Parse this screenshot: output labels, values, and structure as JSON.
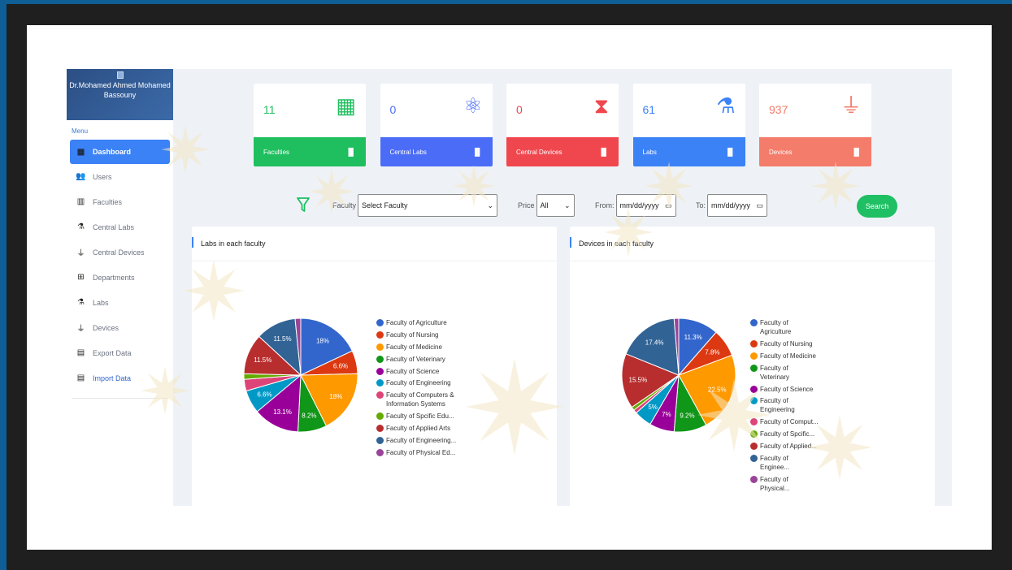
{
  "user": {
    "name": "Dr.Mohamed Ahmed Mohamed Bassouny"
  },
  "sidebar": {
    "menu_label": "Menu",
    "items": [
      {
        "label": "Dashboard",
        "icon": "dashboard-icon",
        "active": true
      },
      {
        "label": "Users",
        "icon": "users-icon"
      },
      {
        "label": "Faculties",
        "icon": "building-icon"
      },
      {
        "label": "Central Labs",
        "icon": "flask-icon"
      },
      {
        "label": "Central Devices",
        "icon": "plug-icon"
      },
      {
        "label": "Departments",
        "icon": "sitemap-icon"
      },
      {
        "label": "Labs",
        "icon": "flask-icon"
      },
      {
        "label": "Devices",
        "icon": "plug-icon"
      },
      {
        "label": "Export Data",
        "icon": "file-export-icon"
      },
      {
        "label": "Import Data",
        "icon": "file-import-icon"
      }
    ]
  },
  "stats": [
    {
      "count": "11",
      "label": "Faculties",
      "icon": "building-icon",
      "color": "#1fbf5f",
      "count_color": "#1fbf5f"
    },
    {
      "count": "0",
      "label": "Central Labs",
      "icon": "atom-icon",
      "color": "#4a6cf7",
      "count_color": "#4a6cf7"
    },
    {
      "count": "0",
      "label": "Central Devices",
      "icon": "dna-icon",
      "color": "#f0474e",
      "count_color": "#f0474e"
    },
    {
      "count": "61",
      "label": "Labs",
      "icon": "flask-icon",
      "color": "#3b82f6",
      "count_color": "#3b82f6"
    },
    {
      "count": "937",
      "label": "Devices",
      "icon": "plug-icon",
      "color": "#f47c6a",
      "count_color": "#f47c6a"
    }
  ],
  "filters": {
    "faculty_label": "Faculty",
    "faculty_value": "Select Faculty",
    "price_label": "Price",
    "price_value": "All",
    "from_label": "From:",
    "from_placeholder": "mm/dd/yyyy",
    "to_label": "To:",
    "to_placeholder": "mm/dd/yyyy",
    "search_label": "Search"
  },
  "chart_data": [
    {
      "type": "pie",
      "title": "Labs in each faculty",
      "categories": [
        "Faculty of Agriculture",
        "Faculty of Nursing",
        "Faculty of Medicine",
        "Faculty of Veterinary",
        "Faculty of Science",
        "Faculty of Engineering",
        "Faculty of Computers & Information Systems",
        "Faculty of Spcific Edu...",
        "Faculty of Applied Arts",
        "Faculty of Engineering...",
        "Faculty of Physical Ed..."
      ],
      "values": [
        18,
        6.6,
        18,
        8.2,
        13.1,
        6.6,
        3.3,
        1.6,
        11.5,
        11.5,
        1.6
      ],
      "slice_labels": [
        "18%",
        "6.6%",
        "18%",
        "8.2%",
        "13.1%",
        "6.6%",
        "",
        "",
        "11.5%",
        "11.5%",
        ""
      ],
      "colors": [
        "#3366cc",
        "#dc3912",
        "#ff9900",
        "#109618",
        "#990099",
        "#0099c6",
        "#dd4477",
        "#66aa00",
        "#b82e2e",
        "#316395",
        "#994499"
      ],
      "legend": "right"
    },
    {
      "type": "pie",
      "title": "Devices in each faculty",
      "categories": [
        "Faculty of Agriculture",
        "Faculty of Nursing",
        "Faculty of Medicine",
        "Faculty of Veterinary",
        "Faculty of Science",
        "Faculty of Engineering",
        "Faculty of Comput...",
        "Faculty of Spcific...",
        "Faculty of Applied...",
        "Faculty of Enginee...",
        "Faculty of Physical..."
      ],
      "values": [
        11.3,
        7.8,
        22.5,
        9.2,
        7,
        5,
        1,
        1,
        15.5,
        17.4,
        1.3
      ],
      "slice_labels": [
        "11.3%",
        "7.8%",
        "22.5%",
        "9.2%",
        "7%",
        "5%",
        "",
        "",
        "15.5%",
        "17.4%",
        ""
      ],
      "colors": [
        "#3366cc",
        "#dc3912",
        "#ff9900",
        "#109618",
        "#990099",
        "#0099c6",
        "#dd4477",
        "#66aa00",
        "#b82e2e",
        "#316395",
        "#994499"
      ],
      "legend": "right"
    }
  ]
}
